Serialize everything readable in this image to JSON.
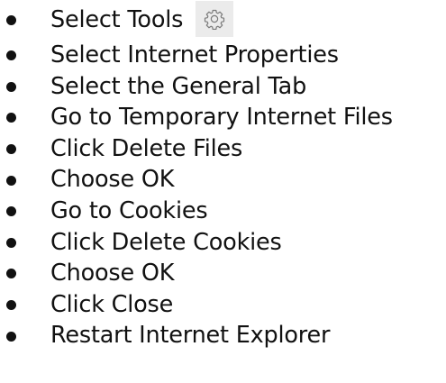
{
  "steps": [
    {
      "label": "Select Tools",
      "icon": "gear-icon"
    },
    {
      "label": "Select Internet Properties"
    },
    {
      "label": "Select the General Tab"
    },
    {
      "label": "Go to Temporary Internet Files"
    },
    {
      "label": "Click Delete Files"
    },
    {
      "label": "Choose OK"
    },
    {
      "label": "Go to Cookies"
    },
    {
      "label": "Click Delete Cookies"
    },
    {
      "label": "Choose OK"
    },
    {
      "label": "Click Close"
    },
    {
      "label": "Restart Internet Explorer"
    }
  ],
  "colors": {
    "text": "#111111",
    "icon_bg": "#ebebeb",
    "icon_stroke": "#7a7a7a"
  }
}
